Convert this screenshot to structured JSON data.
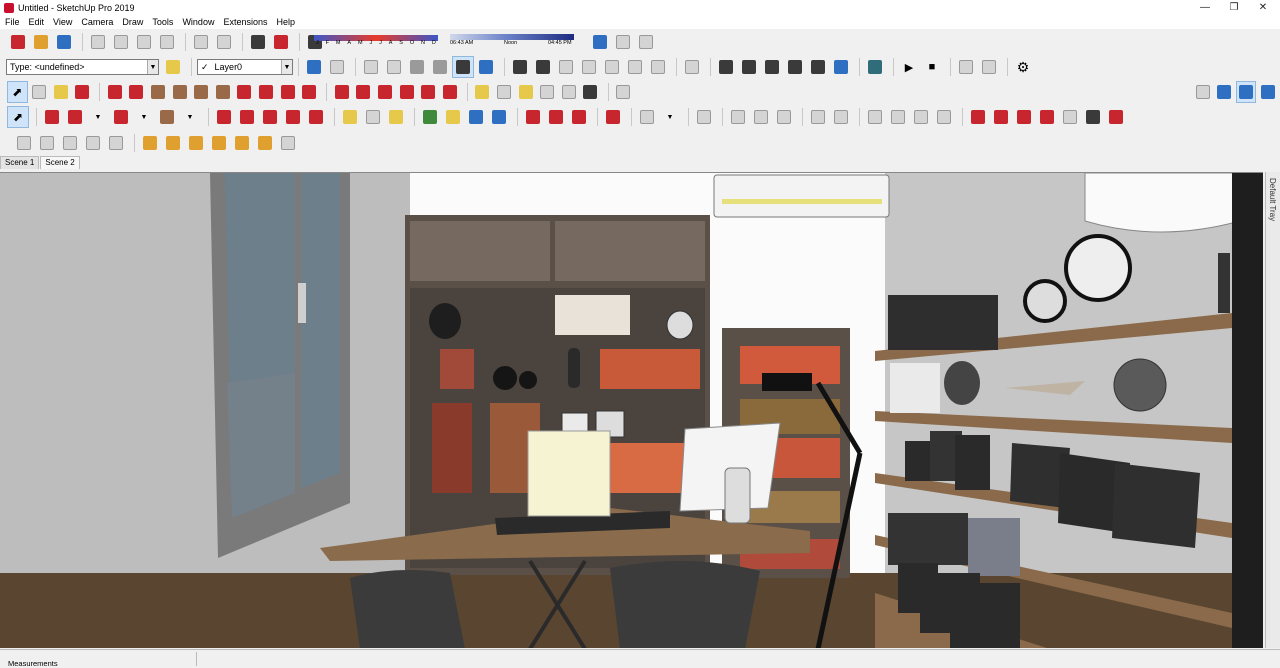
{
  "window": {
    "title": "Untitled - SketchUp Pro 2019",
    "controls": [
      "minimize",
      "maximize",
      "close"
    ]
  },
  "menu": [
    "File",
    "Edit",
    "View",
    "Camera",
    "Draw",
    "Tools",
    "Window",
    "Extensions",
    "Help"
  ],
  "toolbar": {
    "type_combo": "Type: <undefined>",
    "layer_combo": "Layer0",
    "layer_check": "✓",
    "months": [
      "J",
      "F",
      "M",
      "A",
      "M",
      "J",
      "J",
      "A",
      "S",
      "O",
      "N",
      "D"
    ],
    "time_start": "06:43 AM",
    "time_noon": "Noon",
    "time_end": "04:45 PM"
  },
  "scenes": [
    "Scene 1",
    "Scene 2"
  ],
  "tray": {
    "label": "Default Tray"
  },
  "status": {
    "measurements_label": "Measurements"
  },
  "colors": {
    "wall": "#f4f4f4",
    "right_wall": "#c6c6c6",
    "floor": "#5a4630",
    "shelf_wood": "#8a6a4a",
    "desk": "#8a6b4c",
    "cabinet": "#5a5048"
  }
}
